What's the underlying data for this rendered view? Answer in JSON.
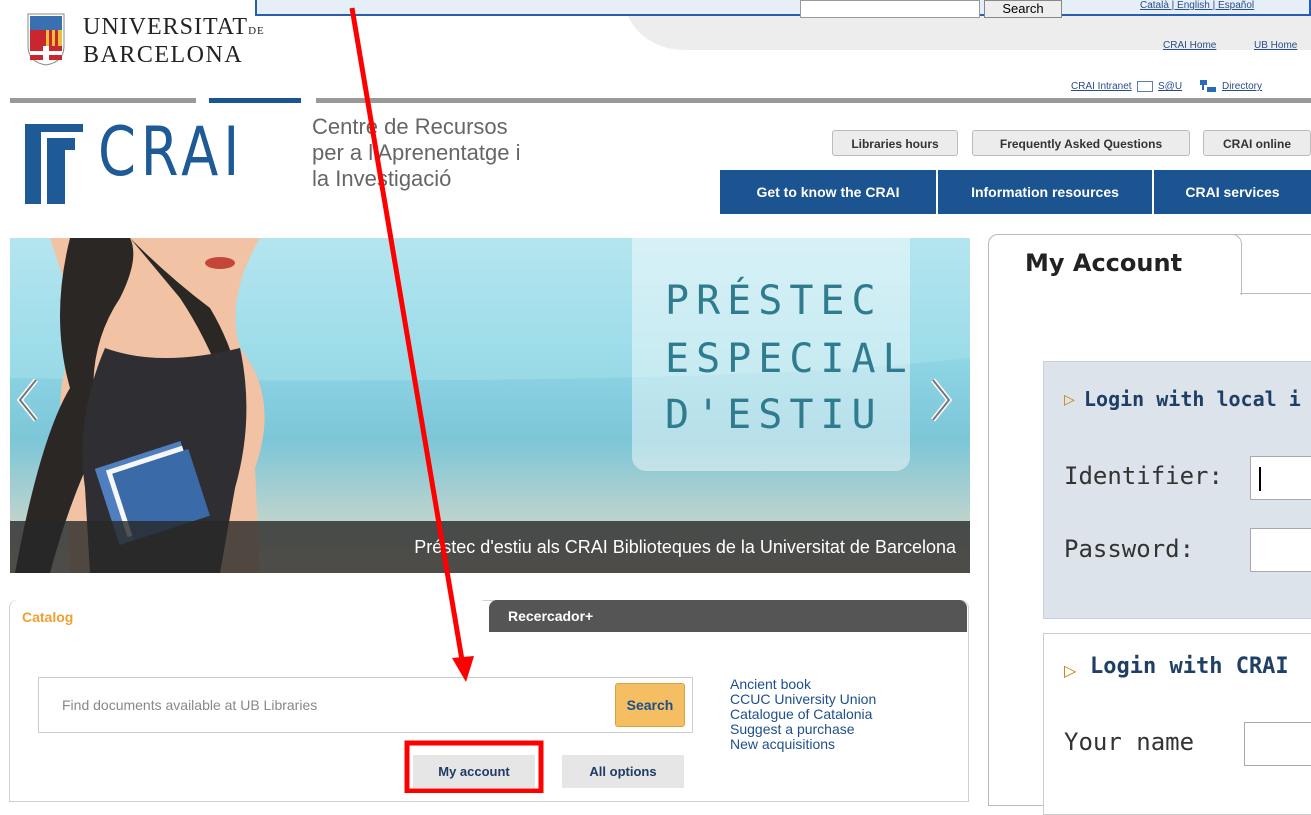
{
  "header": {
    "search_button": "Search",
    "lang_links": "Català | English | Español",
    "links_row1": [
      "CRAI Home",
      "UB Home"
    ],
    "links_row2": [
      "CRAI Intranet",
      "S@U",
      "Directory"
    ]
  },
  "ub_logo": {
    "line1": "UNIVERSITAT",
    "line1_suffix": "DE",
    "line2": "BARCELONA"
  },
  "crai": {
    "logo_text": "CRAI",
    "description": [
      "Centre de Recursos",
      "per a l'Aprenentatge i",
      "la Investigació"
    ],
    "top_buttons": [
      "Libraries hours",
      "Frequently Asked Questions",
      "CRAI online"
    ],
    "nav": [
      "Get to know the CRAI",
      "Information resources",
      "CRAI services"
    ]
  },
  "hero": {
    "promo_lines": [
      "PRÉSTEC",
      "ESPECIAL",
      "D'ESTIU"
    ],
    "caption": "Préstec d'estiu als CRAI Biblioteques de la Universitat de Barcelona",
    "prev_icon": "chevron-left-icon",
    "next_icon": "chevron-right-icon"
  },
  "catalog": {
    "tabs": [
      "Catalog",
      "Recercador+"
    ],
    "search_placeholder": "Find documents available at UB Libraries",
    "search_button": "Search",
    "links": [
      "Ancient book",
      "CCUC University Union",
      "Catalogue of Catalonia",
      "Suggest a purchase",
      "New acquisitions"
    ],
    "my_account": "My account",
    "all_options": "All options"
  },
  "account_panel": {
    "tab": "My Account",
    "local_login_title": "Login with local i",
    "identifier_label": "Identifier:",
    "password_label": "Password:",
    "crai_login_title": "Login with CRAI",
    "your_name_label": "Your name"
  },
  "colors": {
    "brand_blue": "#1b5490",
    "accent_orange": "#f6be63",
    "annotation_red": "#ff0000"
  }
}
